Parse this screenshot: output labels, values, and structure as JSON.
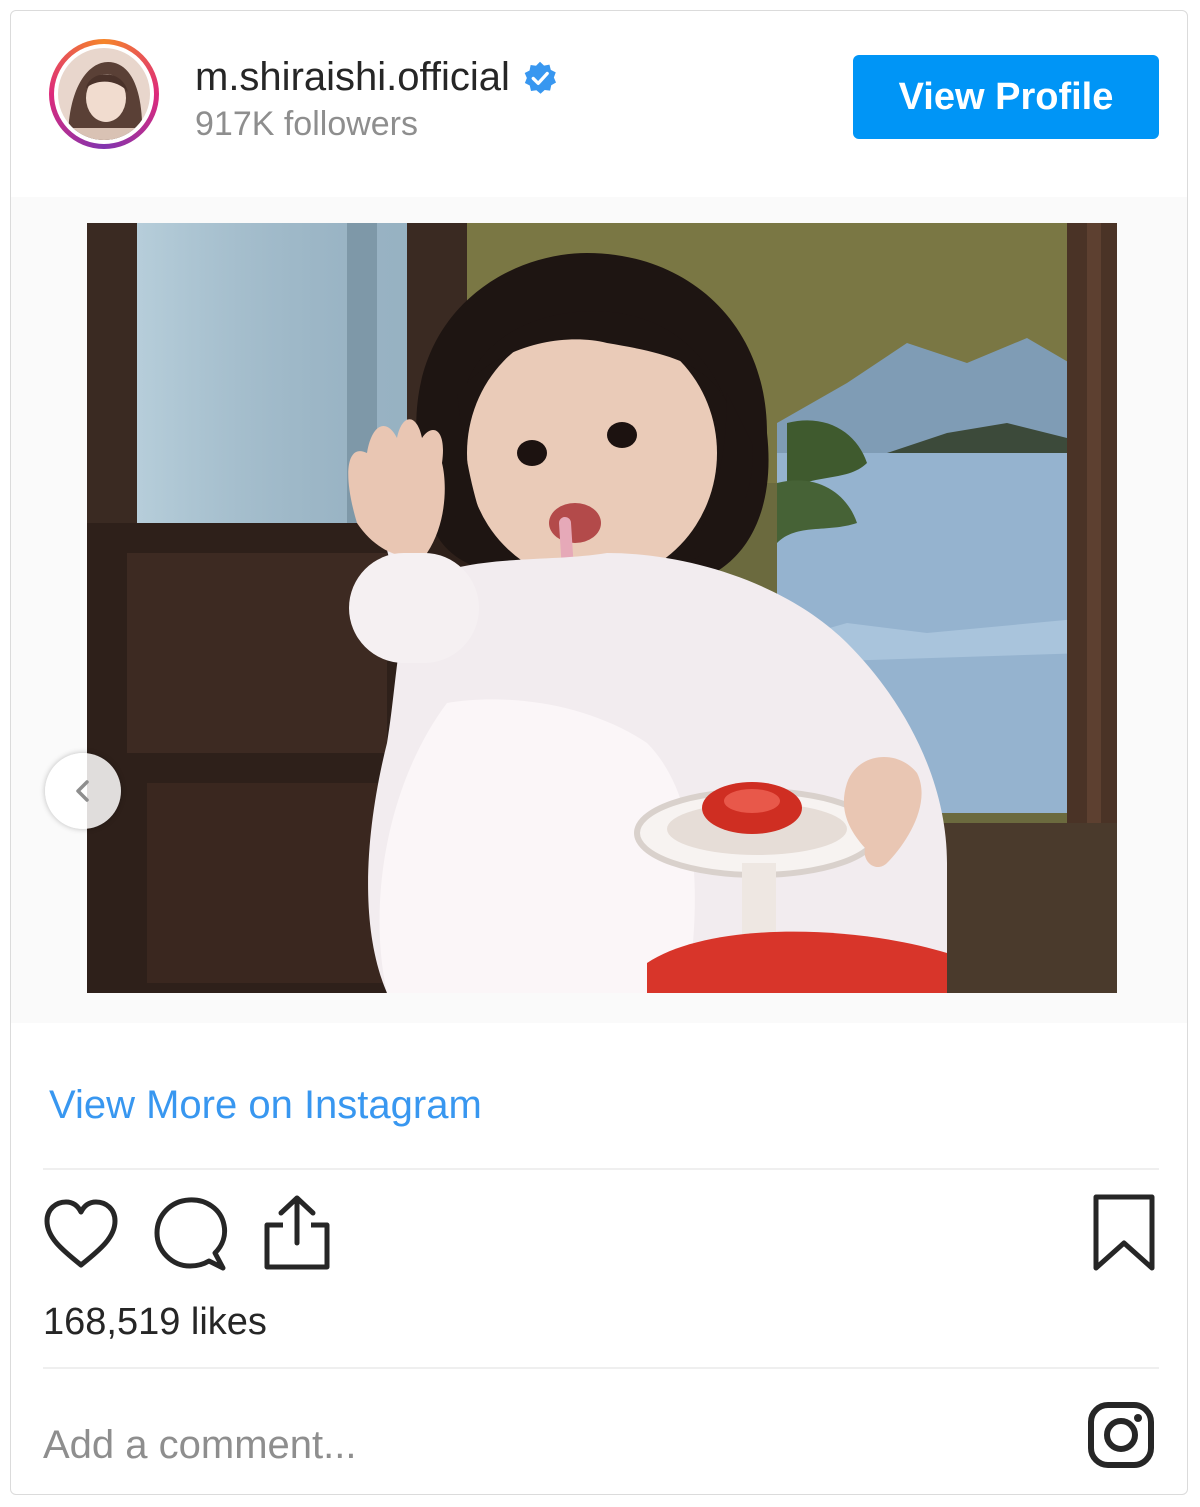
{
  "header": {
    "username": "m.shiraishi.official",
    "followers": "917K followers",
    "view_profile_label": "View Profile"
  },
  "colors": {
    "primary_button": "#0095f6",
    "link": "#3897f0",
    "verified": "#3897f0",
    "text": "#262626",
    "muted": "#8e8e8e"
  },
  "media": {
    "description": "",
    "carousel_slides": 2,
    "active_slide": 2
  },
  "footer": {
    "view_more_label": "View More on Instagram",
    "likes": "168,519 likes",
    "comment_placeholder": "Add a comment..."
  },
  "icons": [
    "heart-icon",
    "comment-icon",
    "share-icon",
    "bookmark-icon",
    "instagram-icon",
    "chevron-left-icon",
    "verified-badge-icon"
  ]
}
